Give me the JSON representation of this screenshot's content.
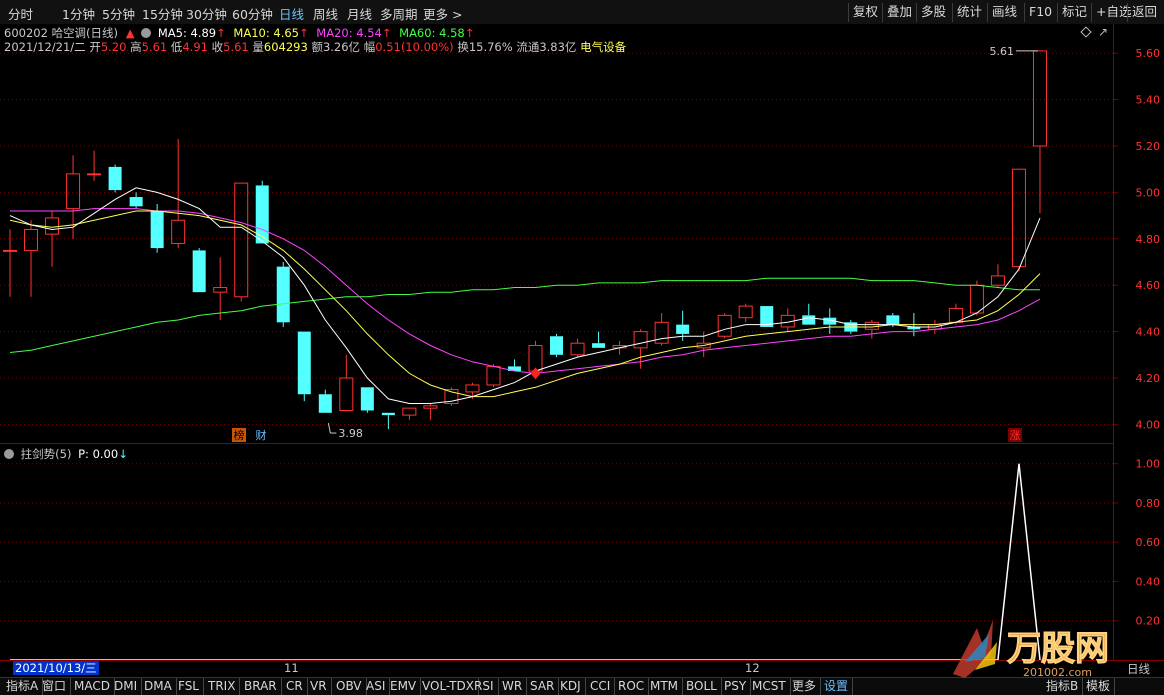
{
  "periods": [
    "分时",
    "1分钟",
    "5分钟",
    "15分钟",
    "30分钟",
    "60分钟",
    "日线",
    "周线",
    "月线",
    "多周期",
    "更多 >"
  ],
  "active_period": "日线",
  "toolbar": [
    "复权",
    "叠加",
    "多股",
    "统计",
    "画线",
    "F10",
    "标记",
    "+自选",
    "返回"
  ],
  "stock": {
    "code": "600202",
    "name": "哈空调(日线)",
    "date": "2021/12/21/二",
    "open_label": "开",
    "open": "5.20",
    "high_label": "高",
    "high": "5.61",
    "low_label": "低",
    "low": "4.91",
    "close_label": "收",
    "close": "5.61",
    "volume_label": "量",
    "volume": "604293",
    "amount_label": "额",
    "amount": "3.26亿",
    "change_label": "幅",
    "change": "0.51(10.00%)",
    "turnover_label": "换",
    "turnover": "15.76%",
    "float_label": "流通",
    "float_cap": "3.83亿",
    "sector": "电气设备"
  },
  "ma": {
    "ma5": {
      "label": "MA5: 4.89",
      "color": "#ffffff"
    },
    "ma10": {
      "label": "MA10: 4.65",
      "color": "#ffff55"
    },
    "ma20": {
      "label": "MA20: 4.54",
      "color": "#ff44ff"
    },
    "ma60": {
      "label": "MA60: 4.58",
      "color": "#44ff44"
    }
  },
  "markers": {
    "bang": "榜",
    "cai": "财",
    "zhang": "涨",
    "low_value": "3.98",
    "high_value": "5.61"
  },
  "indicator": {
    "name": "拄剑势(5)",
    "value": "P: 0.00"
  },
  "date_axis": {
    "cursor": "2021/10/13/三",
    "months": [
      "11",
      "12"
    ],
    "right_label": "日线"
  },
  "bottom_tabs": [
    "指标A",
    "窗口",
    "MACD",
    "DMI",
    "DMA",
    "FSL",
    "TRIX",
    "BRAR",
    "CR",
    "VR",
    "OBV",
    "ASI",
    "EMV",
    "VOL-TDX",
    "RSI",
    "WR",
    "SAR",
    "KDJ",
    "CCI",
    "ROC",
    "MTM",
    "BOLL",
    "PSY",
    "MCST",
    "更多",
    "设置"
  ],
  "bottom_right_tabs": [
    "指标B",
    "模板"
  ],
  "watermark": {
    "text": "万股网",
    "url": "201002.com"
  },
  "colors": {
    "up": "#ff3232",
    "down": "#54ffff",
    "grid": "#7a0000",
    "axis_text": "#ff3232"
  },
  "chart_data": [
    {
      "type": "candlestick",
      "title": "600202 哈空调(日线)",
      "ylim": [
        3.95,
        5.7
      ],
      "yticks": [
        4.0,
        4.2,
        4.4,
        4.6,
        4.8,
        5.0,
        5.2,
        5.4,
        5.6
      ],
      "candles": [
        {
          "o": 4.75,
          "h": 4.84,
          "l": 4.55,
          "c": 4.75
        },
        {
          "o": 4.75,
          "h": 4.88,
          "l": 4.55,
          "c": 4.84
        },
        {
          "o": 4.82,
          "h": 4.92,
          "l": 4.68,
          "c": 4.89
        },
        {
          "o": 4.93,
          "h": 5.16,
          "l": 4.8,
          "c": 5.08
        },
        {
          "o": 5.08,
          "h": 5.18,
          "l": 5.05,
          "c": 5.08
        },
        {
          "o": 5.11,
          "h": 5.12,
          "l": 5.0,
          "c": 5.01
        },
        {
          "o": 4.98,
          "h": 5.0,
          "l": 4.93,
          "c": 4.94
        },
        {
          "o": 4.92,
          "h": 4.95,
          "l": 4.74,
          "c": 4.76
        },
        {
          "o": 4.78,
          "h": 5.23,
          "l": 4.76,
          "c": 4.88
        },
        {
          "o": 4.75,
          "h": 4.76,
          "l": 4.57,
          "c": 4.57
        },
        {
          "o": 4.57,
          "h": 4.72,
          "l": 4.45,
          "c": 4.59
        },
        {
          "o": 4.55,
          "h": 5.04,
          "l": 4.53,
          "c": 5.04
        },
        {
          "o": 5.03,
          "h": 5.05,
          "l": 4.78,
          "c": 4.78
        },
        {
          "o": 4.68,
          "h": 4.7,
          "l": 4.42,
          "c": 4.44
        },
        {
          "o": 4.4,
          "h": 4.4,
          "l": 4.1,
          "c": 4.13
        },
        {
          "o": 4.13,
          "h": 4.15,
          "l": 4.05,
          "c": 4.05
        },
        {
          "o": 4.06,
          "h": 4.3,
          "l": 4.06,
          "c": 4.2
        },
        {
          "o": 4.16,
          "h": 4.16,
          "l": 4.05,
          "c": 4.06
        },
        {
          "o": 4.05,
          "h": 4.05,
          "l": 3.98,
          "c": 4.04
        },
        {
          "o": 4.04,
          "h": 4.07,
          "l": 4.02,
          "c": 4.07
        },
        {
          "o": 4.07,
          "h": 4.09,
          "l": 4.02,
          "c": 4.08
        },
        {
          "o": 4.09,
          "h": 4.16,
          "l": 4.08,
          "c": 4.15
        },
        {
          "o": 4.14,
          "h": 4.18,
          "l": 4.11,
          "c": 4.17
        },
        {
          "o": 4.17,
          "h": 4.26,
          "l": 4.16,
          "c": 4.25
        },
        {
          "o": 4.25,
          "h": 4.28,
          "l": 4.23,
          "c": 4.23
        },
        {
          "o": 4.23,
          "h": 4.36,
          "l": 4.22,
          "c": 4.34
        },
        {
          "o": 4.38,
          "h": 4.39,
          "l": 4.29,
          "c": 4.3
        },
        {
          "o": 4.3,
          "h": 4.37,
          "l": 4.29,
          "c": 4.35
        },
        {
          "o": 4.35,
          "h": 4.4,
          "l": 4.33,
          "c": 4.33
        },
        {
          "o": 4.33,
          "h": 4.36,
          "l": 4.3,
          "c": 4.34
        },
        {
          "o": 4.33,
          "h": 4.41,
          "l": 4.24,
          "c": 4.4
        },
        {
          "o": 4.35,
          "h": 4.48,
          "l": 4.34,
          "c": 4.44
        },
        {
          "o": 4.43,
          "h": 4.49,
          "l": 4.36,
          "c": 4.39
        },
        {
          "o": 4.33,
          "h": 4.4,
          "l": 4.29,
          "c": 4.35
        },
        {
          "o": 4.38,
          "h": 4.48,
          "l": 4.37,
          "c": 4.47
        },
        {
          "o": 4.46,
          "h": 4.52,
          "l": 4.44,
          "c": 4.51
        },
        {
          "o": 4.51,
          "h": 4.51,
          "l": 4.42,
          "c": 4.42
        },
        {
          "o": 4.42,
          "h": 4.5,
          "l": 4.4,
          "c": 4.47
        },
        {
          "o": 4.47,
          "h": 4.52,
          "l": 4.43,
          "c": 4.43
        },
        {
          "o": 4.46,
          "h": 4.5,
          "l": 4.39,
          "c": 4.43
        },
        {
          "o": 4.44,
          "h": 4.45,
          "l": 4.39,
          "c": 4.4
        },
        {
          "o": 4.41,
          "h": 4.45,
          "l": 4.37,
          "c": 4.44
        },
        {
          "o": 4.47,
          "h": 4.48,
          "l": 4.42,
          "c": 4.43
        },
        {
          "o": 4.42,
          "h": 4.48,
          "l": 4.38,
          "c": 4.41
        },
        {
          "o": 4.41,
          "h": 4.45,
          "l": 4.39,
          "c": 4.43
        },
        {
          "o": 4.44,
          "h": 4.52,
          "l": 4.43,
          "c": 4.5
        },
        {
          "o": 4.48,
          "h": 4.62,
          "l": 4.47,
          "c": 4.6
        },
        {
          "o": 4.6,
          "h": 4.69,
          "l": 4.59,
          "c": 4.64
        },
        {
          "o": 4.68,
          "h": 5.1,
          "l": 4.66,
          "c": 5.1
        },
        {
          "o": 5.2,
          "h": 5.61,
          "l": 4.91,
          "c": 5.61
        }
      ],
      "ma5": [
        4.9,
        4.86,
        4.84,
        4.85,
        4.91,
        4.97,
        5.02,
        5.0,
        4.97,
        4.93,
        4.85,
        4.85,
        4.79,
        4.72,
        4.6,
        4.45,
        4.33,
        4.2,
        4.11,
        4.09,
        4.09,
        4.1,
        4.12,
        4.15,
        4.18,
        4.23,
        4.26,
        4.29,
        4.31,
        4.33,
        4.35,
        4.37,
        4.38,
        4.38,
        4.41,
        4.43,
        4.43,
        4.44,
        4.46,
        4.45,
        4.43,
        4.43,
        4.43,
        4.42,
        4.42,
        4.44,
        4.48,
        4.55,
        4.67,
        4.89
      ],
      "ma10": [
        4.88,
        4.86,
        4.85,
        4.86,
        4.88,
        4.9,
        4.92,
        4.92,
        4.91,
        4.9,
        4.88,
        4.86,
        4.81,
        4.75,
        4.67,
        4.58,
        4.49,
        4.39,
        4.3,
        4.22,
        4.17,
        4.14,
        4.12,
        4.12,
        4.14,
        4.16,
        4.19,
        4.22,
        4.24,
        4.26,
        4.29,
        4.31,
        4.33,
        4.34,
        4.36,
        4.38,
        4.39,
        4.4,
        4.41,
        4.42,
        4.42,
        4.42,
        4.43,
        4.43,
        4.43,
        4.44,
        4.45,
        4.49,
        4.56,
        4.65
      ],
      "ma20": [
        4.92,
        4.92,
        4.92,
        4.92,
        4.93,
        4.93,
        4.93,
        4.92,
        4.92,
        4.91,
        4.89,
        4.87,
        4.84,
        4.8,
        4.75,
        4.68,
        4.6,
        4.52,
        4.45,
        4.39,
        4.34,
        4.3,
        4.27,
        4.25,
        4.23,
        4.22,
        4.23,
        4.24,
        4.25,
        4.26,
        4.27,
        4.29,
        4.3,
        4.32,
        4.33,
        4.34,
        4.35,
        4.36,
        4.37,
        4.38,
        4.38,
        4.39,
        4.4,
        4.4,
        4.41,
        4.42,
        4.43,
        4.45,
        4.49,
        4.54
      ],
      "ma60": [
        4.31,
        4.32,
        4.34,
        4.36,
        4.38,
        4.4,
        4.42,
        4.44,
        4.45,
        4.47,
        4.48,
        4.49,
        4.51,
        4.52,
        4.53,
        4.54,
        4.55,
        4.55,
        4.56,
        4.56,
        4.57,
        4.57,
        4.58,
        4.58,
        4.59,
        4.59,
        4.6,
        4.6,
        4.61,
        4.61,
        4.61,
        4.62,
        4.62,
        4.62,
        4.62,
        4.62,
        4.63,
        4.63,
        4.63,
        4.63,
        4.63,
        4.62,
        4.62,
        4.62,
        4.61,
        4.6,
        4.6,
        4.59,
        4.58,
        4.58
      ]
    },
    {
      "type": "line",
      "title": "拄剑势(5)",
      "ylim": [
        0,
        1.08
      ],
      "yticks": [
        0.2,
        0.4,
        0.6,
        0.8,
        1.0
      ],
      "values": [
        0,
        0,
        0,
        0,
        0,
        0,
        0,
        0,
        0,
        0,
        0,
        0,
        0,
        0,
        0,
        0,
        0,
        0,
        0,
        0,
        0,
        0,
        0,
        0,
        0,
        0,
        0,
        0,
        0,
        0,
        0,
        0,
        0,
        0,
        0,
        0,
        0,
        0,
        0,
        0,
        0,
        0,
        0,
        0,
        0,
        0,
        0,
        0,
        1,
        0
      ]
    }
  ]
}
